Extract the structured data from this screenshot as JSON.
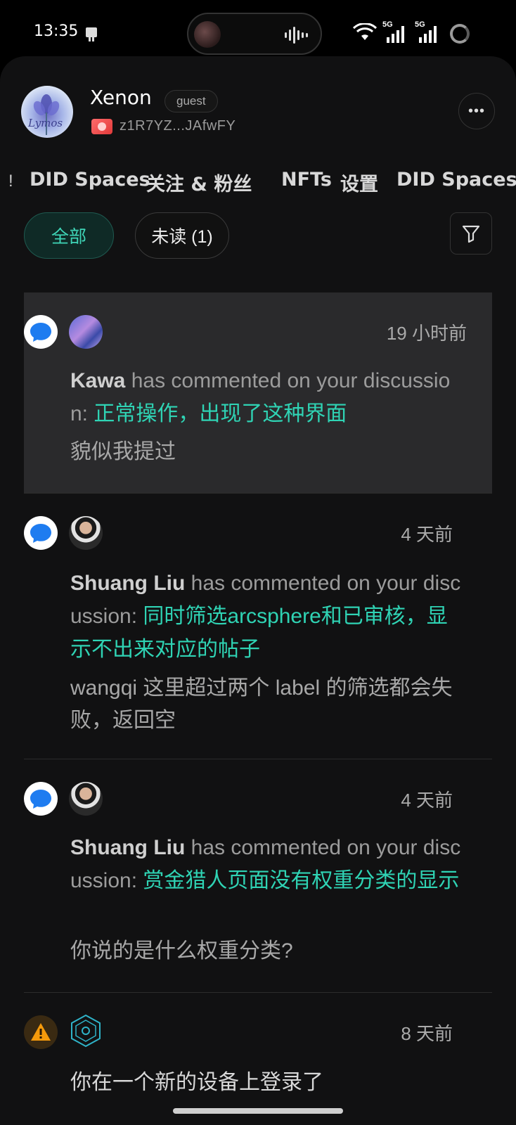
{
  "status_bar": {
    "time": "13:35",
    "network_1": "5G",
    "network_2": "5G"
  },
  "profile": {
    "avatar_text": "Lymos",
    "name": "Xenon",
    "role_badge": "guest",
    "did": "z1R7YZ...JAfwFY"
  },
  "tabs": {
    "leading_fragment": "!",
    "items": [
      {
        "label": "DID Spaces"
      },
      {
        "label": "关注 & 粉丝"
      },
      {
        "label": "NFTs"
      },
      {
        "label": "设置"
      },
      {
        "label": "DID Spaces"
      }
    ]
  },
  "filters": {
    "all_label": "全部",
    "unread_label": "未读 (1)"
  },
  "notifications": [
    {
      "actor": "Kawa",
      "text_before": " has commented on your discussion: ",
      "title": "正常操作，出现了这种界面",
      "quote": "貌似我提过",
      "time": "19 小时前",
      "unread": true
    },
    {
      "actor": "Shuang Liu",
      "text_before": " has commented on your discussion: ",
      "title": "同时筛选arcsphere和已审核，显示不出来对应的帖子",
      "quote": "wangqi 这里超过两个 label 的筛选都会失败，返回空",
      "time": "4 天前",
      "unread": false
    },
    {
      "actor": "Shuang Liu",
      "text_before": " has commented on your discussion: ",
      "title": "赏金猎人页面没有权重分类的显示",
      "quote": "你说的是什么权重分类?",
      "time": "4 天前",
      "unread": false
    },
    {
      "title_cut": "你在一个新的设备上登录了",
      "time": "8 天前"
    }
  ],
  "colors": {
    "accent": "#2fd3b4",
    "panel_bg": "#111112",
    "unread_bg": "#2a2a2c",
    "message_icon": "#1e7cf0",
    "warning_icon": "#f59a0b"
  },
  "icons": {
    "message": "chat-bubble-icon",
    "warning": "warning-triangle-icon",
    "system": "gear-hexagon-icon",
    "filter": "filter-funnel-icon",
    "more": "more-dots-icon"
  }
}
